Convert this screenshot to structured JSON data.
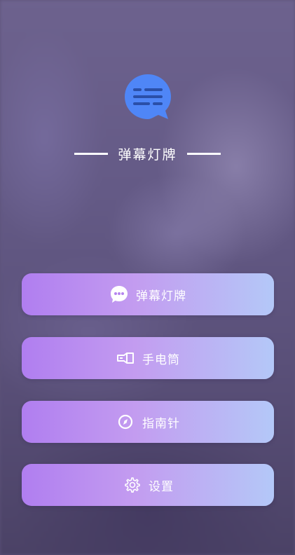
{
  "header": {
    "logo_icon": "chat-bubble-icon",
    "title": "弹幕灯牌"
  },
  "menu": {
    "items": [
      {
        "label": "弹幕灯牌",
        "icon": "chat-bubble-icon"
      },
      {
        "label": "手电筒",
        "icon": "flashlight-icon"
      },
      {
        "label": "指南针",
        "icon": "compass-icon"
      },
      {
        "label": "设置",
        "icon": "gear-icon"
      }
    ]
  },
  "colors": {
    "logo": "#4f86f7",
    "button_gradient_start": "#b07ef0",
    "button_gradient_end": "#b4c8f8",
    "text": "#ffffff"
  }
}
